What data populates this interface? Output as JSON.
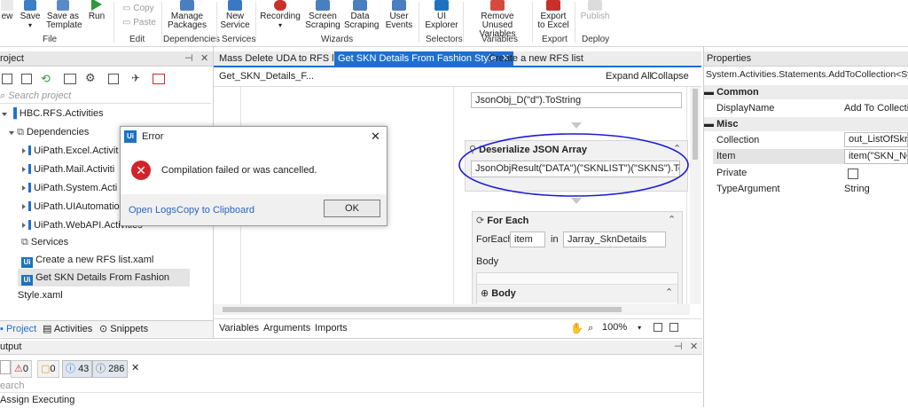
{
  "ribbon": {
    "buttons": [
      {
        "label": "ew",
        "icon": "new-icon"
      },
      {
        "label": "Save",
        "icon": "save-icon"
      },
      {
        "label": "Save as Template",
        "icon": "save-template-icon"
      },
      {
        "label": "Run",
        "icon": "run-icon"
      },
      {
        "label": "Manage Packages",
        "icon": "manage-packages-icon"
      },
      {
        "label": "New Service",
        "icon": "new-service-icon"
      },
      {
        "label": "Recording",
        "icon": "recording-icon"
      },
      {
        "label": "Screen Scraping",
        "icon": "screen-scraping-icon"
      },
      {
        "label": "Data Scraping",
        "icon": "data-scraping-icon"
      },
      {
        "label": "User Events",
        "icon": "user-events-icon"
      },
      {
        "label": "UI Explorer",
        "icon": "ui-explorer-icon"
      },
      {
        "label": "Remove Unused Variables",
        "icon": "remove-variables-icon"
      },
      {
        "label": "Export to Excel",
        "icon": "export-excel-icon"
      },
      {
        "label": "Publish",
        "icon": "publish-icon"
      }
    ],
    "copy": "Copy",
    "paste": "Paste",
    "groups": [
      "File",
      "Edit",
      "Dependencies",
      "Services",
      "Wizards",
      "Selectors",
      "Variables",
      "Export",
      "Deploy"
    ]
  },
  "project": {
    "title": "roject",
    "search_placeholder": "Search project",
    "root": "HBC.RFS.Activities",
    "dependencies": "Dependencies",
    "deps": [
      "UiPath.Excel.Activit",
      "UiPath.Mail.Activiti",
      "UiPath.System.Acti",
      "UiPath.UIAutomatio",
      "UiPath.WebAPI.Activities"
    ],
    "services": "Services",
    "files": [
      "Create a new RFS list.xaml",
      "Get SKN Details From Fashion Style.xaml"
    ],
    "bottom_tabs": [
      "Project",
      "Activities",
      "Snippets"
    ]
  },
  "designer": {
    "tabs": [
      "Mass Delete UDA to RFS list",
      "Get SKN Details From Fashion Style",
      "Create a new RFS list"
    ],
    "breadcrumb": "Get_SKN_Details_F...",
    "expand_all": "Expand All",
    "collapse_all": "Collapse All",
    "top_field": "JsonObj_D(\"d\").ToString",
    "deserialize_title": "Deserialize JSON Array",
    "deserialize_value": "JsonObjResult(\"DATA\")(\"SKNLIST\")(\"SKNS\").ToString",
    "foreach_title": "For Each",
    "foreach_label": "ForEach",
    "foreach_item": "item",
    "in_label": "in",
    "foreach_collection": "Jarray_SknDetails",
    "body_label": "Body",
    "body_title": "Body",
    "bottom_tabs": [
      "Variables",
      "Arguments",
      "Imports"
    ],
    "zoom": "100%"
  },
  "dialog": {
    "title": "Error",
    "message": "Compilation failed or was cancelled.",
    "open_logs": "Open Logs",
    "copy_clipboard": "Copy to Clipboard",
    "ok": "OK"
  },
  "properties": {
    "title": "Properties",
    "type_name": "System.Activities.Statements.AddToCollection<System.St",
    "common": "Common",
    "display_name_label": "DisplayName",
    "display_name_value": "Add To Collection",
    "misc": "Misc",
    "collection_label": "Collection",
    "collection_value": "out_ListOfSkn",
    "item_label": "Item",
    "item_value": "item(\"SKN_NO\").",
    "private_label": "Private",
    "type_argument_label": "TypeArgument",
    "type_argument_value": "String"
  },
  "output": {
    "title": "utput",
    "errors": "0",
    "warnings": "0",
    "info": "43",
    "trace": "286",
    "search_placeholder": "earch",
    "line": "Assign Executing"
  }
}
